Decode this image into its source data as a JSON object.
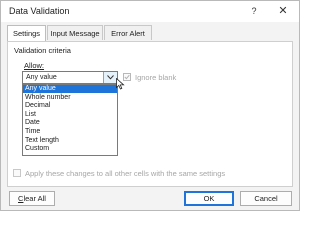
{
  "window": {
    "title": "Data Validation",
    "help_label": "?",
    "close_label": "✕"
  },
  "tabs": [
    {
      "label": "Settings",
      "active": true
    },
    {
      "label": "Input Message",
      "active": false
    },
    {
      "label": "Error Alert",
      "active": false
    }
  ],
  "settings": {
    "section_label": "Validation criteria",
    "allow_label": "Allow:",
    "allow_value": "Any value",
    "ignore_blank_label": "Ignore blank",
    "ignore_blank_checked": true,
    "allow_options": [
      {
        "label": "Any value",
        "selected": true
      },
      {
        "label": "Whole number",
        "selected": false
      },
      {
        "label": "Decimal",
        "selected": false
      },
      {
        "label": "List",
        "selected": false
      },
      {
        "label": "Date",
        "selected": false
      },
      {
        "label": "Time",
        "selected": false
      },
      {
        "label": "Text length",
        "selected": false
      },
      {
        "label": "Custom",
        "selected": false
      }
    ],
    "apply_all_label": "Apply these changes to all other cells with the same settings",
    "apply_all_checked": false
  },
  "buttons": {
    "clear_all": "Clear All",
    "ok": "OK",
    "cancel": "Cancel"
  },
  "colors": {
    "accent": "#1e74d8",
    "disabled_text": "#a6a6a6"
  }
}
